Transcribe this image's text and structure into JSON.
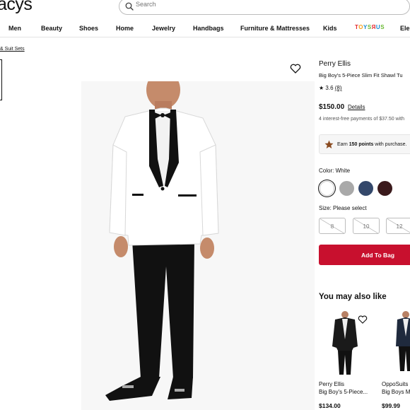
{
  "header": {
    "logo": "acys",
    "search_placeholder": "Search"
  },
  "nav": {
    "items": [
      "Men",
      "Beauty",
      "Shoes",
      "Home",
      "Jewelry",
      "Handbags",
      "Furniture & Mattresses",
      "Kids"
    ],
    "toysrus": [
      "T",
      "O",
      "Y",
      "S",
      "Я",
      "U",
      "S"
    ],
    "partial": "Ele"
  },
  "breadcrumb": "& Suit Sets",
  "product": {
    "brand": "Perry Ellis",
    "name": "Big Boy's 5-Piece Slim Fit Shawl Tu",
    "rating": "3.6",
    "review_count": "(8)",
    "price": "$150.00",
    "details_link": "Details",
    "installments": "4 interest-free payments of $37.50 with",
    "earn": {
      "prefix": "Earn ",
      "points": "150 points",
      "suffix": " with purchase."
    },
    "color_label": "Color: White",
    "colors": [
      "#ffffff",
      "#a9a9a9",
      "#34486b",
      "#3b1a1c"
    ],
    "size_label": "Size: Please select",
    "sizes": [
      "8",
      "10",
      "12"
    ],
    "add_to_bag": "Add To Bag"
  },
  "recommendations": {
    "title": "You may also like",
    "items": [
      {
        "brand": "Perry Ellis",
        "name": "Big Boy's 5-Piece...",
        "price": "$134.00"
      },
      {
        "brand": "OppoSuits",
        "name": "Big Boys M",
        "price": "$99.99"
      }
    ]
  }
}
